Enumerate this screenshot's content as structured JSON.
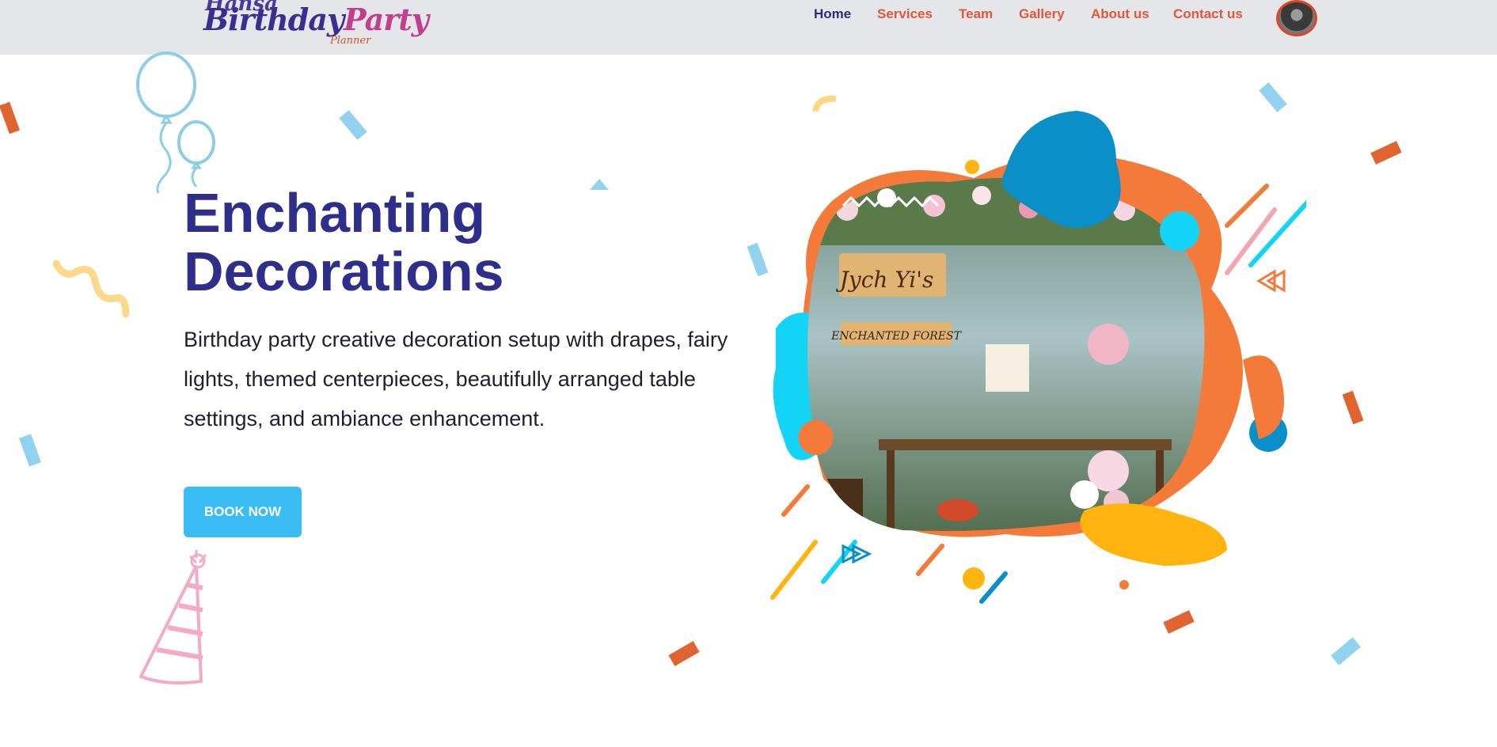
{
  "logo": {
    "line1": "Hansa",
    "line2a": "Birthday",
    "line2b": "Party",
    "line3": "Planner"
  },
  "nav": {
    "items": [
      "Home",
      "Services",
      "Team",
      "Gallery",
      "About us",
      "Contact us"
    ],
    "active": "Home"
  },
  "hero": {
    "title_line1": "Enchanting",
    "title_line2": "Decorations",
    "description": "Birthday party creative decoration setup with drapes, fairy lights, themed centerpieces, beautifully arranged table settings, and ambiance enhancement.",
    "button_label": "BOOK NOW"
  },
  "image": {
    "sign_line1": "Jych Yi's",
    "sign_line2": "ENCHANTED FOREST"
  },
  "colors": {
    "header_bg": "#e5e6ea",
    "title": "#2e2f8a",
    "nav": "#e0573a",
    "nav_active": "#2b2e78",
    "button": "#3bbdf4",
    "orange": "#f47a3a",
    "blue": "#0a8fc8",
    "cyan": "#13d4f4",
    "yellow": "#ffb40f"
  },
  "icons": [
    "balloon-icon",
    "party-hat-icon",
    "confetti-icon"
  ]
}
